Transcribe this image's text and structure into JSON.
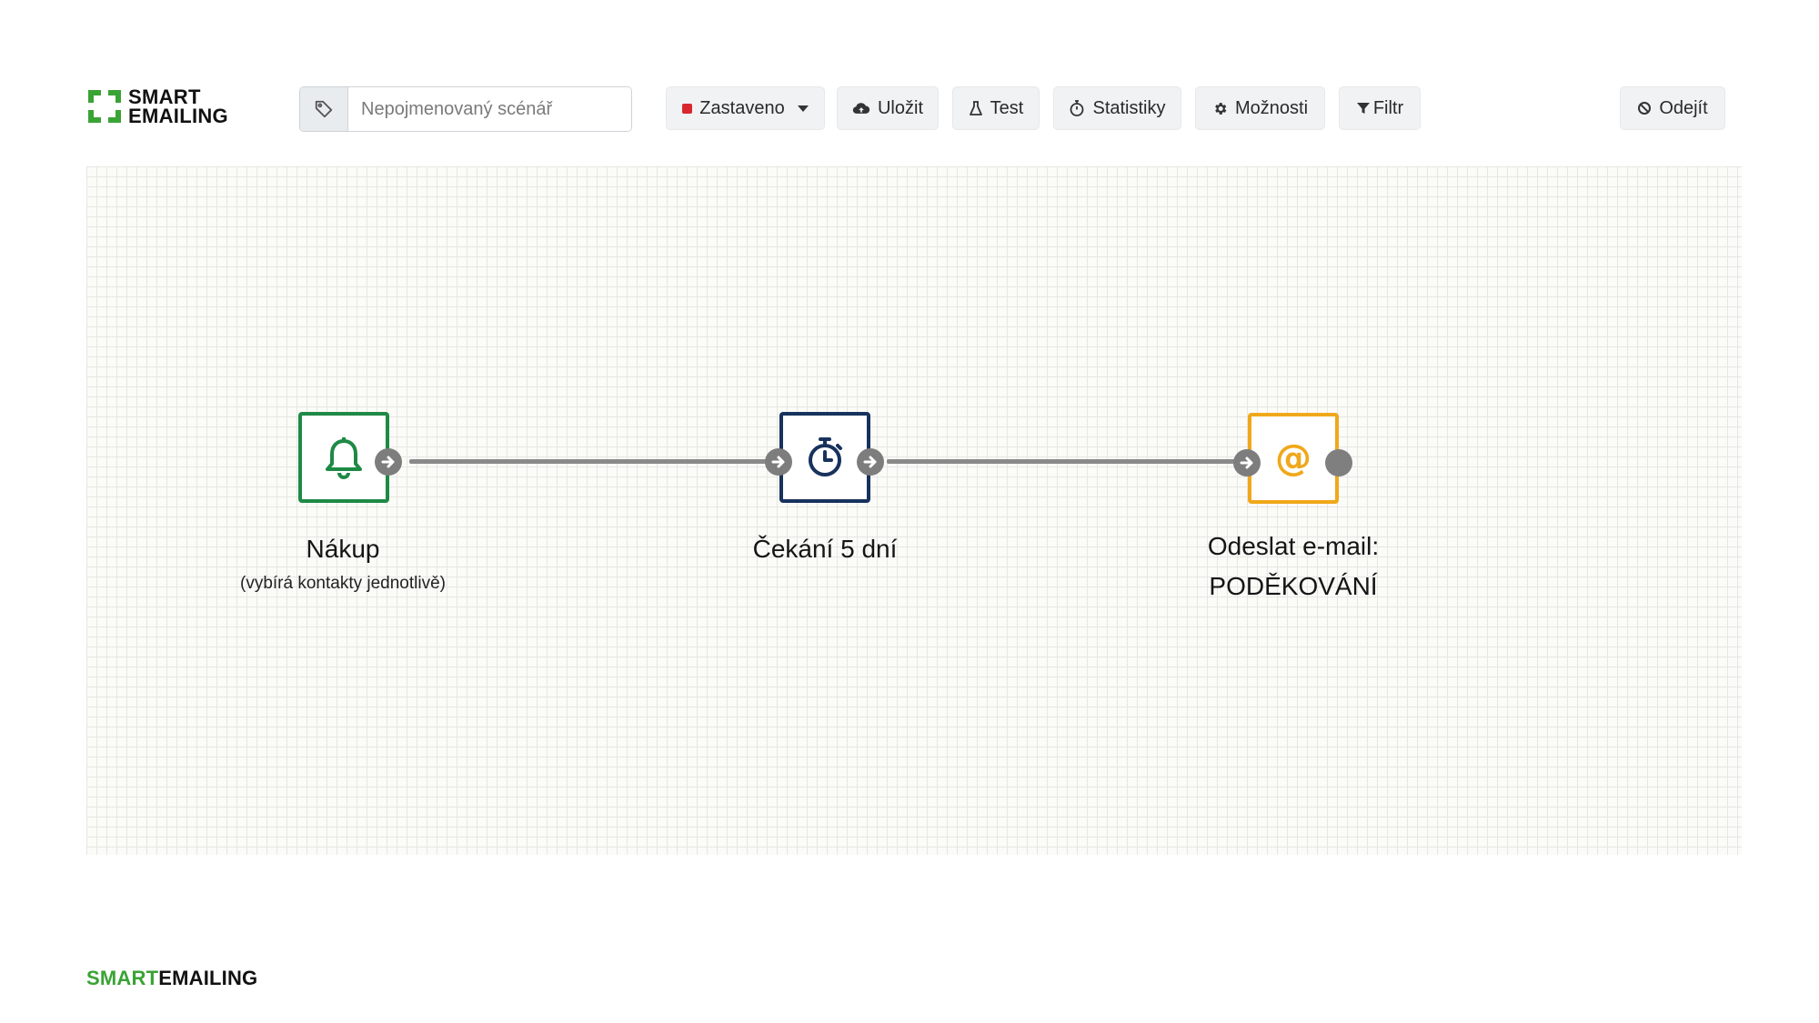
{
  "brand": {
    "logo_line1": "SMART",
    "logo_line2": "EMAILING",
    "footer_part1": "SMART",
    "footer_part2": "EMAILING",
    "green": "#3aa335"
  },
  "toolbar": {
    "scenario_name_placeholder": "Nepojmenovaný scénář",
    "scenario_name_value": "",
    "tag_icon": "tag-icon",
    "status_label": "Zastaveno",
    "status_color": "#d9272e",
    "save_label": "Uložit",
    "test_label": "Test",
    "stats_label": "Statistiky",
    "options_label": "Možnosti",
    "filter_label": "Filtr",
    "exit_label": "Odejít"
  },
  "flow": {
    "nodes": [
      {
        "type": "trigger",
        "icon": "bell-icon",
        "label": "Nákup",
        "sublabel": "(vybírá kontakty jednotlivě)",
        "color": "#1e8a45"
      },
      {
        "type": "wait",
        "icon": "stopwatch-icon",
        "label": "Čekání 5 dní",
        "color": "#17325c"
      },
      {
        "type": "email",
        "icon": "at-sign-icon",
        "label_line1": "Odeslat e-mail:",
        "label_line2": "PODĚKOVÁNÍ",
        "color": "#f0a81b"
      }
    ]
  }
}
